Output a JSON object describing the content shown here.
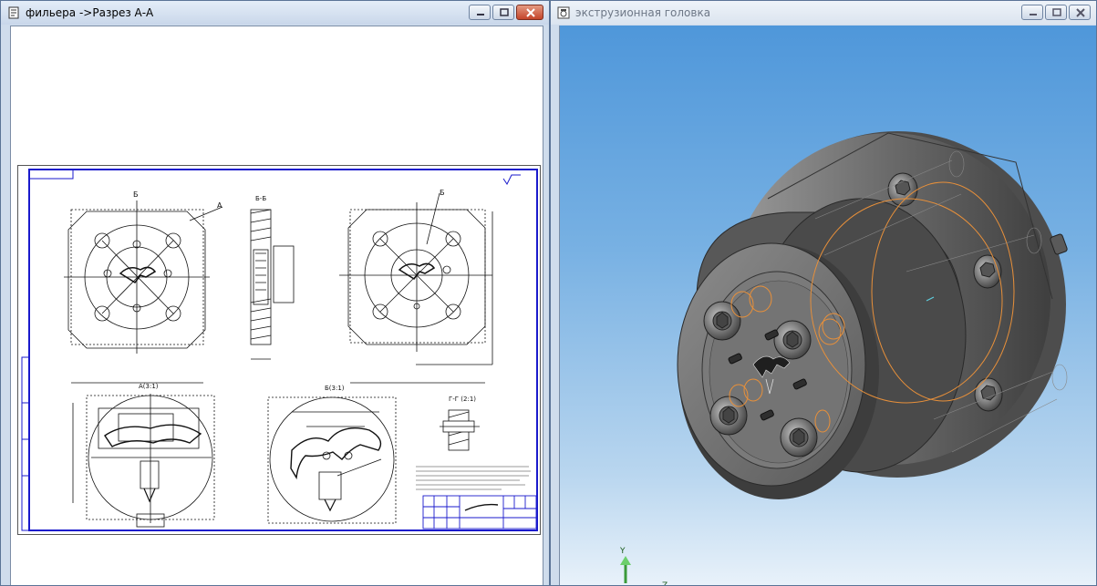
{
  "left_window": {
    "title": "фильера ->Разрез А-А",
    "controls": {
      "minimize": "minimize-icon",
      "maximize": "maximize-icon",
      "close": "close-icon"
    }
  },
  "right_window": {
    "title": "экструзионная головка",
    "controls": {
      "minimize": "minimize-icon",
      "maximize": "maximize-icon",
      "close": "close-icon"
    }
  },
  "drawing": {
    "labels": {
      "cut_b": "Б",
      "cut_a": "А",
      "section_bb": "Б-Б",
      "view_b": "Б",
      "detail_b": "Б(3:1)",
      "section_gg": "Г-Г (2:1)",
      "view_a": "А(3:1)"
    }
  },
  "viewport": {
    "axis_y": "Y",
    "axis_z": "Z"
  },
  "colors": {
    "frame_blue": "#1a1acc",
    "title_bar": "#c9d7ea",
    "close_red": "#c4452a",
    "model_gray": "#6e6e6e",
    "highlight_orange": "#e8903a"
  }
}
